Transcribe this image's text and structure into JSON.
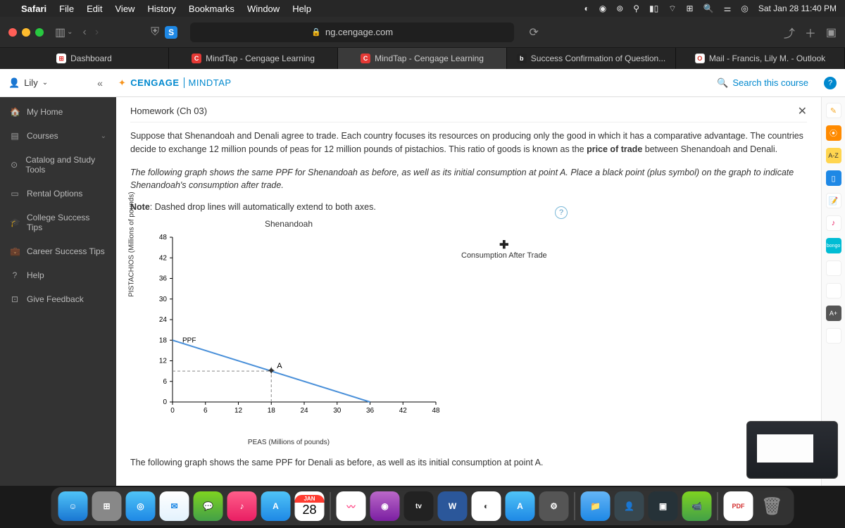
{
  "menubar": {
    "app": "Safari",
    "items": [
      "File",
      "Edit",
      "View",
      "History",
      "Bookmarks",
      "Window",
      "Help"
    ],
    "datetime": "Sat Jan 28  11:40 PM"
  },
  "browser": {
    "url_host": "ng.cengage.com",
    "tabs": [
      {
        "label": "Dashboard",
        "favicon_bg": "#ffffff",
        "favicon_txt": "⊞",
        "favicon_color": "#e53935"
      },
      {
        "label": "MindTap - Cengage Learning",
        "favicon_bg": "#e53935",
        "favicon_txt": "C",
        "favicon_color": "#fff"
      },
      {
        "label": "MindTap - Cengage Learning",
        "favicon_bg": "#e53935",
        "favicon_txt": "C",
        "favicon_color": "#fff",
        "active": true
      },
      {
        "label": "Success Confirmation of Question...",
        "favicon_bg": "#222",
        "favicon_txt": "b",
        "favicon_color": "#fff"
      },
      {
        "label": "Mail - Francis, Lily M. - Outlook",
        "favicon_bg": "#fff",
        "favicon_txt": "O",
        "favicon_color": "#d93025"
      }
    ]
  },
  "app": {
    "user": "Lily",
    "brand1": "CENGAGE",
    "brand2": "MINDTAP",
    "search_label": "Search this course",
    "homework_title": "Homework (Ch 03)"
  },
  "left_nav": [
    {
      "icon": "🏠",
      "label": "My Home"
    },
    {
      "icon": "▤",
      "label": "Courses",
      "chev": "⌄"
    },
    {
      "icon": "⊙",
      "label": "Catalog and Study Tools"
    },
    {
      "icon": "▭",
      "label": "Rental Options"
    },
    {
      "icon": "🎓",
      "label": "College Success Tips"
    },
    {
      "icon": "💼",
      "label": "Career Success Tips"
    },
    {
      "icon": "?",
      "label": "Help"
    },
    {
      "icon": "⊡",
      "label": "Give Feedback"
    }
  ],
  "content": {
    "p1a": "Suppose that Shenandoah and Denali agree to trade. Each country focuses its resources on producing only the good in which it has a comparative advantage. The countries decide to exchange 12 million pounds of peas for 12 million pounds of pistachios. This ratio of goods is known as the ",
    "p1b": "price of trade",
    "p1c": " between Shenandoah and Denali.",
    "p2": "The following graph shows the same PPF for Shenandoah as before, as well as its initial consumption at point A. Place a black point (plus symbol) on the graph to indicate Shenandoah's consumption after trade.",
    "note_label": "Note",
    "note_text": ": Dashed drop lines will automatically extend to both axes.",
    "legend_tool": "Consumption After Trade",
    "p3": "The following graph shows the same PPF for Denali as before, as well as its initial consumption at point A."
  },
  "chart_data": {
    "type": "line",
    "title": "Shenandoah",
    "xlabel": "PEAS (Millions of pounds)",
    "ylabel": "PISTACHIOS (Millions of pounds)",
    "x_ticks": [
      0,
      6,
      12,
      18,
      24,
      30,
      36,
      42,
      48
    ],
    "y_ticks": [
      0,
      6,
      12,
      18,
      24,
      30,
      36,
      42,
      48
    ],
    "xlim": [
      0,
      48
    ],
    "ylim": [
      0,
      48
    ],
    "series": [
      {
        "name": "PPF",
        "color": "#4a90d9",
        "points": [
          {
            "x": 0,
            "y": 18
          },
          {
            "x": 36,
            "y": 0
          }
        ]
      }
    ],
    "annotations": [
      {
        "name": "A",
        "x": 18,
        "y": 9,
        "symbol": "star",
        "droplines": true
      }
    ]
  },
  "dock": {
    "cal_month": "JAN",
    "cal_day": "28"
  }
}
